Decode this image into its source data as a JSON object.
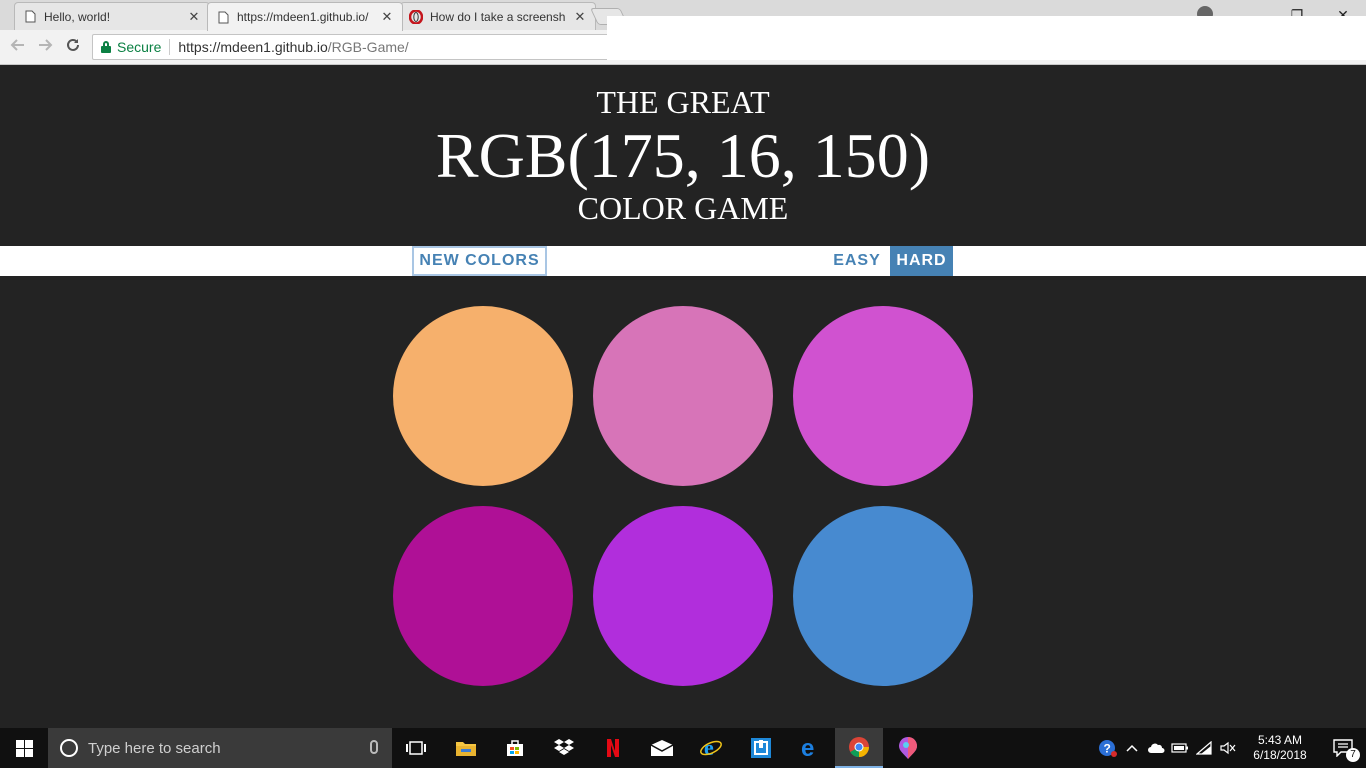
{
  "browser": {
    "tabs": [
      {
        "title": "Hello, world!",
        "favicon": "page-icon",
        "active": false
      },
      {
        "title": "https://mdeen1.github.io/",
        "favicon": "page-icon",
        "active": true
      },
      {
        "title": "How do I take a screensh",
        "favicon": "opera-icon",
        "active": false
      }
    ],
    "close_glyph": "✕",
    "secure_label": "Secure",
    "url_host": "https://mdeen1.github.io",
    "url_path": "/RGB-Game/",
    "window_controls": {
      "minimize": "—",
      "restore": "❐",
      "close": "✕"
    }
  },
  "game": {
    "title_line1": "THE GREAT",
    "target_color": "RGB(175, 16, 150)",
    "title_line3": "COLOR GAME",
    "new_colors_label": "New Colors",
    "easy_label": "Easy",
    "hard_label": "Hard",
    "selected_mode": "hard",
    "squares": [
      {
        "color": "#f6b06c"
      },
      {
        "color": "#d774b8"
      },
      {
        "color": "#d052d0"
      },
      {
        "color": "#af1096"
      },
      {
        "color": "#b12edc"
      },
      {
        "color": "#478ad0"
      }
    ],
    "header_bg": "#232323",
    "accent": "#4682b4"
  },
  "taskbar": {
    "search_placeholder": "Type here to search",
    "pinned": [
      "task-view-icon",
      "file-explorer-icon",
      "store-icon",
      "dropbox-icon",
      "netflix-icon",
      "mail-icon",
      "internet-explorer-icon",
      "app-icon",
      "edge-icon",
      "chrome-icon",
      "paint-3d-icon"
    ],
    "time": "5:43 AM",
    "date": "6/18/2018",
    "notification_count": "7"
  }
}
